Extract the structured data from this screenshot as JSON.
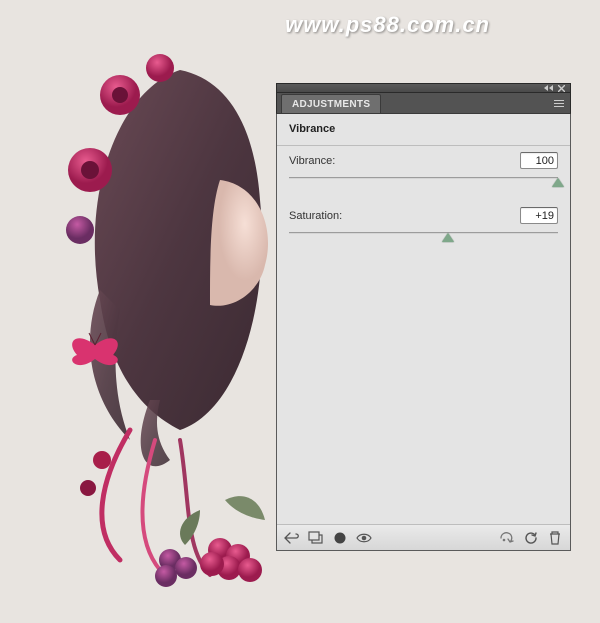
{
  "watermark": "www.ps88.com.cn",
  "panel": {
    "tab_label": "ADJUSTMENTS",
    "title": "Vibrance",
    "sliders": {
      "vibrance": {
        "label": "Vibrance:",
        "value": "100",
        "pos_pct": 100
      },
      "saturation": {
        "label": "Saturation:",
        "value": "+19",
        "pos_pct": 59
      }
    },
    "icons": {
      "collapse": "collapse-icon",
      "close": "close-icon",
      "menu": "menu-icon",
      "back": "back-arrow-icon",
      "clip": "clip-to-layer-icon",
      "visibility": "eye-icon",
      "view_prev": "view-previous-icon",
      "reset": "reset-icon",
      "trash": "trash-icon"
    }
  }
}
